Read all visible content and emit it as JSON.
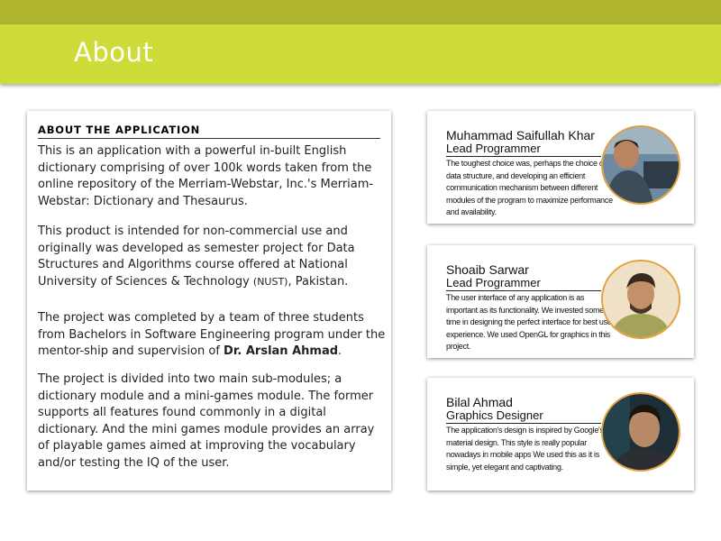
{
  "header": {
    "title": "About"
  },
  "about": {
    "heading": "ABOUT THE APPLICATION",
    "p1": "This is an application with a powerful in-built English dictionary comprising of over 100k words taken from the online repository of the Merriam-Webstar, Inc.'s Merriam-Webstar: Dictionary and Thesaurus.",
    "p2": "This product is intended for non-commercial use and originally was developed as semester project for Data Structures and Algorithms course offered at National University of Sciences & Technology",
    "p2_abbr": "(NUST)",
    "p2_end": ", Pakistan.",
    "p3": "The project was completed by a team of three students from Bachelors in Software Engineering program under the mentor-ship and supervision of",
    "p3_name": "Dr. Arslan Ahmad",
    "p3_end": ".",
    "p4": "The project is divided into two main sub-modules; a dictionary module and a mini-games module. The former supports all features found commonly in a digital dictionary. And the mini games module provides an array of playable games aimed at improving the vocabulary and/or testing the IQ of the user."
  },
  "team": [
    {
      "name": "Muhammad Saifullah Khar",
      "role": "Lead Programmer",
      "desc": "The toughest choice was, perhaps the choice of data structure, and developing an efficient communication mechanism between different modules of the program to maximize performance and availability."
    },
    {
      "name": "Shoaib Sarwar",
      "role": "Lead Programmer",
      "desc": "The user interface of any application is as important as its functionality. We invested some time in designing the perfect interface for best user experience. We used OpenGL for graphics in this project."
    },
    {
      "name": "Bilal Ahmad",
      "role": "Graphics Designer",
      "desc": "The application's design is inspired by Google's material design. This style is really popular nowadays in mobile apps We used this as it is simple, yet elegant and captivating."
    }
  ],
  "colors": {
    "accent": "#cddc39",
    "accent_dark": "#afb52d",
    "avatar_border": "#e2a13a"
  }
}
